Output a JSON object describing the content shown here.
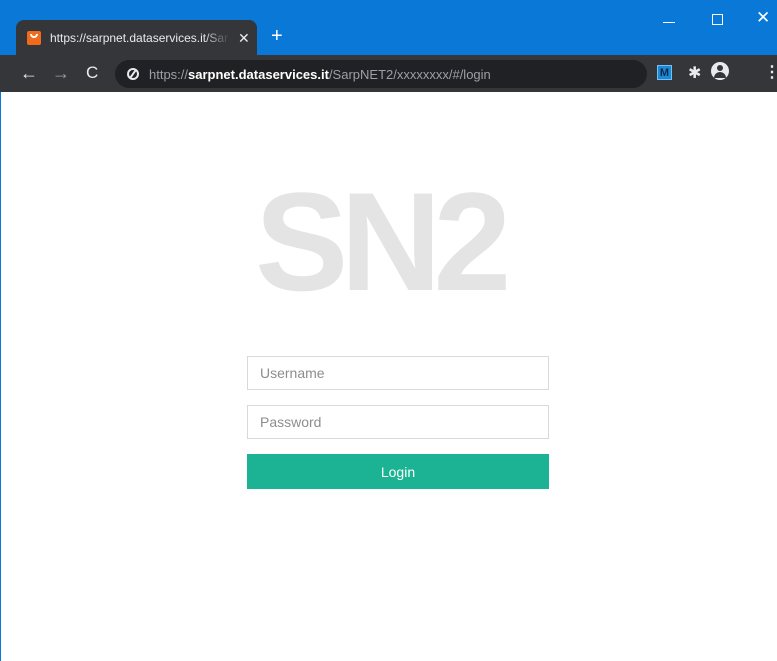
{
  "browser": {
    "tab": {
      "title": "https://sarpnet.dataservices.it/Sar",
      "close_glyph": "✕"
    },
    "new_tab_glyph": "+",
    "window_controls": {
      "close_glyph": "✕"
    },
    "toolbar": {
      "back_glyph": "←",
      "forward_glyph": "→",
      "reload_glyph": "C",
      "url_scheme": "https://",
      "url_host": "sarpnet.dataservices.it",
      "url_path": "/SarpNET2/xxxxxxxx/#/login",
      "extension_label": "M",
      "puzzle_glyph": "✱",
      "menu_glyph": "⋮"
    },
    "colors": {
      "titlebar": "#0a78d7",
      "toolbar": "#35363a",
      "accent": "#1bb394"
    }
  },
  "login": {
    "logo_text": "SN2",
    "username_placeholder": "Username",
    "password_placeholder": "Password",
    "login_label": "Login"
  }
}
